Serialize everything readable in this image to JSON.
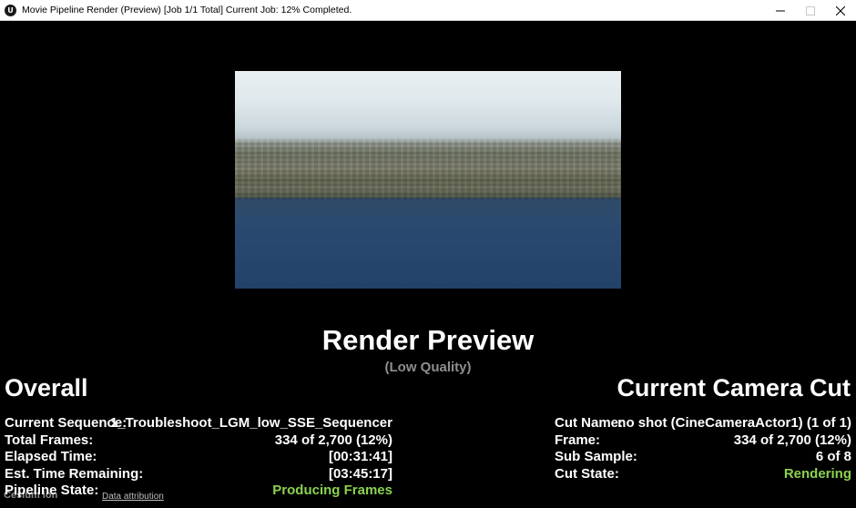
{
  "window": {
    "title": "Movie Pipeline Render (Preview) [Job 1/1 Total] Current Job: 12% Completed.",
    "app_icon": "unreal-engine-logo",
    "buttons": [
      "minimize-icon",
      "maximize-icon",
      "close-icon"
    ]
  },
  "preview": {
    "title": "Render Preview",
    "subtitle": "(Low Quality)"
  },
  "overall": {
    "title": "Overall",
    "rows": [
      {
        "label": "Current Sequence:",
        "value": "1_Troubleshoot_LGM_low_SSE_Sequencer"
      },
      {
        "label": "Total Frames:",
        "value": "334 of 2,700 (12%)"
      },
      {
        "label": "Elapsed Time:",
        "value": "[00:31:41]"
      },
      {
        "label": "Est. Time Remaining:",
        "value": "[03:45:17]"
      },
      {
        "label": "Pipeline State:",
        "value": "Producing Frames"
      }
    ]
  },
  "camera_cut": {
    "title": "Current Camera Cut",
    "rows": [
      {
        "label": "Cut Name:",
        "value": "no shot (CineCameraActor1) (1 of 1)"
      },
      {
        "label": "Frame:",
        "value": "334 of 2,700 (12%)"
      },
      {
        "label": "Sub Sample:",
        "value": "6 of 8"
      },
      {
        "label": "Cut State:",
        "value": "Rendering"
      }
    ]
  },
  "overlay": {
    "logo_text": "Cesium ion",
    "attribution": "Data attribution"
  },
  "colors": {
    "status_green": "#8bd24e",
    "subtitle_gray": "#8e8e8e"
  }
}
